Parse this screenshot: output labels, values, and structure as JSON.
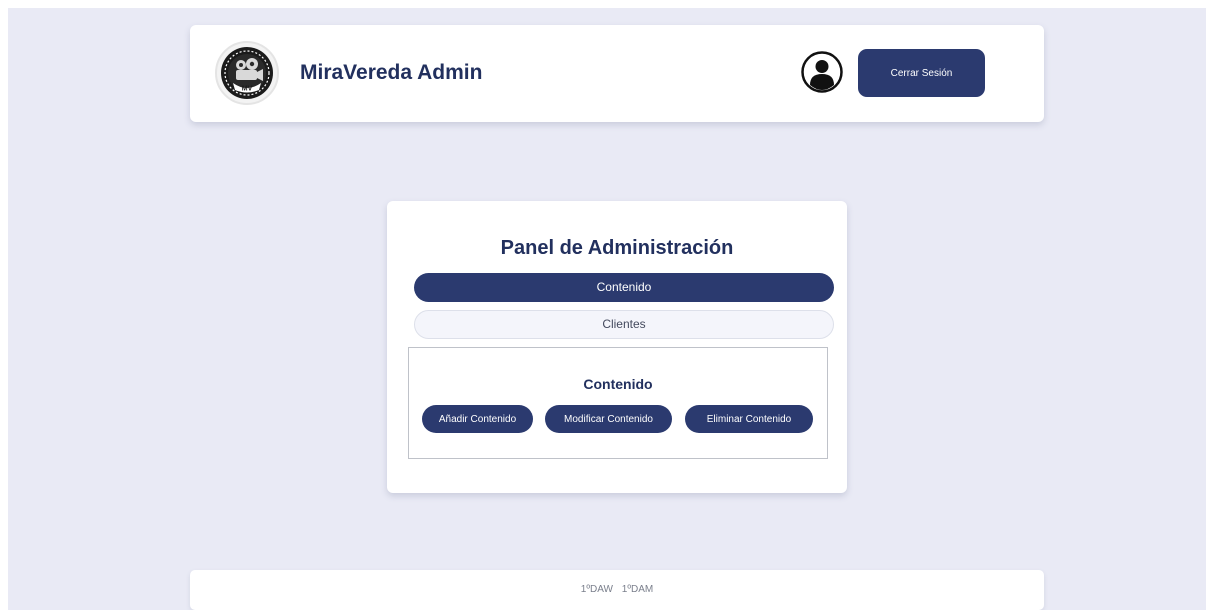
{
  "header": {
    "logo_icon": "camera-reel-logo-icon",
    "logo_text": "MV",
    "title": "MiraVereda Admin",
    "user_icon": "user-avatar-icon",
    "logout_label": "Cerrar Sesión"
  },
  "panel": {
    "title": "Panel de Administración",
    "tabs": [
      {
        "label": "Contenido",
        "active": true
      },
      {
        "label": "Clientes",
        "active": false
      }
    ],
    "section": {
      "title": "Contenido",
      "buttons": [
        {
          "label": "Añadir Contenido"
        },
        {
          "label": "Modificar Contenido"
        },
        {
          "label": "Eliminar Contenido"
        }
      ]
    }
  },
  "footer": {
    "items": [
      "1ºDAW",
      "1ºDAM"
    ]
  },
  "colors": {
    "primary": "#2b3a6f",
    "title_text": "#22305e",
    "background": "#e9eaf5",
    "card": "#ffffff"
  }
}
